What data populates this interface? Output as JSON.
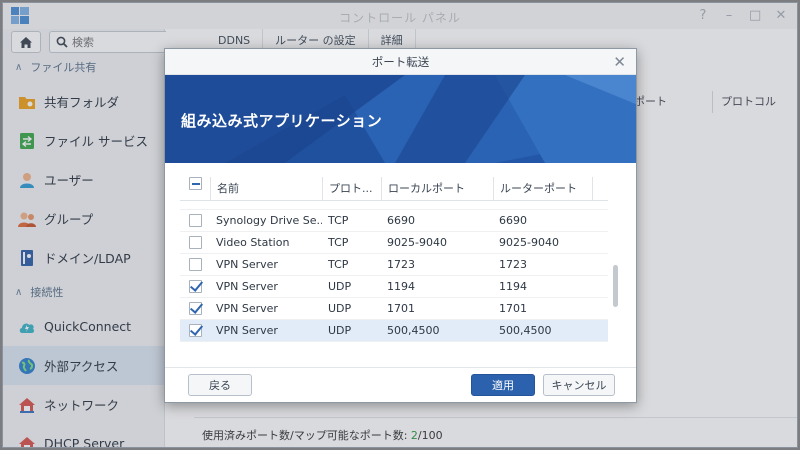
{
  "app": {
    "title": "コントロール パネル",
    "window_buttons": [
      "?",
      "–",
      "□",
      "✕"
    ]
  },
  "sidebar": {
    "search_placeholder": "検索",
    "sections": [
      {
        "label": "ファイル共有"
      },
      {
        "label": "接続性"
      }
    ],
    "items": [
      {
        "label": "共有フォルダ",
        "icon": "shared-folder-icon"
      },
      {
        "label": "ファイル サービス",
        "icon": "file-services-icon"
      },
      {
        "label": "ユーザー",
        "icon": "user-icon"
      },
      {
        "label": "グループ",
        "icon": "group-icon"
      },
      {
        "label": "ドメイン/LDAP",
        "icon": "domain-ldap-icon"
      },
      {
        "label": "QuickConnect",
        "icon": "quickconnect-icon"
      },
      {
        "label": "外部アクセス",
        "icon": "external-access-icon",
        "active": true
      },
      {
        "label": "ネットワーク",
        "icon": "network-icon"
      },
      {
        "label": "DHCP Server",
        "icon": "dhcp-server-icon"
      }
    ]
  },
  "main": {
    "tabs": [
      {
        "label": "DDNS"
      },
      {
        "label": "ルーター の設定",
        "active": true
      },
      {
        "label": "詳細"
      }
    ],
    "bg_columns": [
      "ポート",
      "プロトコル"
    ],
    "status": {
      "prefix": "使用済みポート数/マップ可能なポート数: ",
      "used": "2",
      "sep": "/",
      "total": "100"
    }
  },
  "dialog": {
    "title": "ポート転送",
    "banner_title": "組み込み式アプリケーション",
    "columns": [
      "名前",
      "プロト...",
      "ローカルポート",
      "ルーターポート"
    ],
    "rows": [
      {
        "checked": false,
        "name": "Synology Drive Se...",
        "protocol": "TCP",
        "local": "6690",
        "router": "6690",
        "selected": false
      },
      {
        "checked": false,
        "name": "Video Station",
        "protocol": "TCP",
        "local": "9025-9040",
        "router": "9025-9040",
        "selected": false
      },
      {
        "checked": false,
        "name": "VPN Server",
        "protocol": "TCP",
        "local": "1723",
        "router": "1723",
        "selected": false
      },
      {
        "checked": true,
        "name": "VPN Server",
        "protocol": "UDP",
        "local": "1194",
        "router": "1194",
        "selected": false
      },
      {
        "checked": true,
        "name": "VPN Server",
        "protocol": "UDP",
        "local": "1701",
        "router": "1701",
        "selected": false
      },
      {
        "checked": true,
        "name": "VPN Server",
        "protocol": "UDP",
        "local": "500,4500",
        "router": "500,4500",
        "selected": true
      }
    ],
    "buttons": {
      "back": "戻る",
      "apply": "適用",
      "cancel": "キャンセル"
    },
    "colors": {
      "banner_dark": "#1e4e9c",
      "banner_light": "#3a78c8",
      "primary_button": "#2c62ad"
    }
  }
}
